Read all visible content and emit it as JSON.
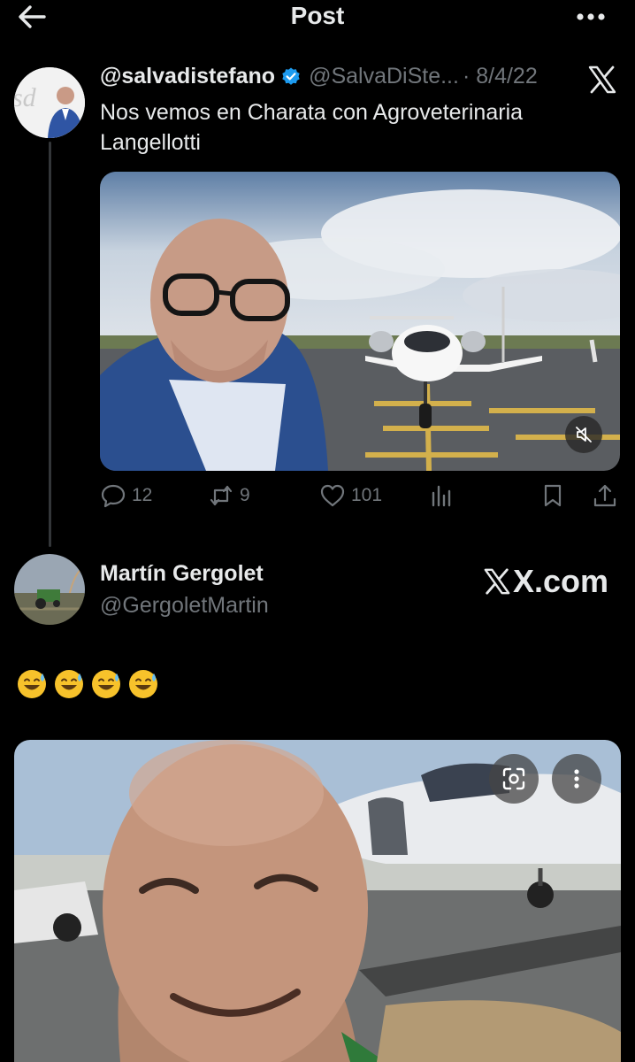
{
  "header": {
    "title": "Post"
  },
  "thread": {
    "parent": {
      "display_name": "@salvadistefano",
      "handle": "@SalvaDiSte...",
      "date": "· 8/4/22",
      "text": "Nos vemos en Charata con Agroveterinaria Langellotti",
      "stats": {
        "replies": "12",
        "reposts": "9",
        "likes": "101"
      }
    },
    "reply": {
      "display_name": "Martín Gergolet",
      "handle": "@GergoletMartin",
      "watermark": "X.com",
      "text": "😅😅😅😅"
    }
  },
  "colors": {
    "background": "#000000",
    "text_primary": "#e7e9ea",
    "text_secondary": "#71767b",
    "verified_blue": "#1d9bf0",
    "divider": "#333639"
  },
  "icons": [
    "back-arrow-icon",
    "more-icon",
    "verified-badge-icon",
    "x-logo-icon",
    "reply-icon",
    "repost-icon",
    "like-icon",
    "views-icon",
    "bookmark-icon",
    "share-icon",
    "mute-icon",
    "lens-icon",
    "emoji-sweat-smile-icon"
  ]
}
